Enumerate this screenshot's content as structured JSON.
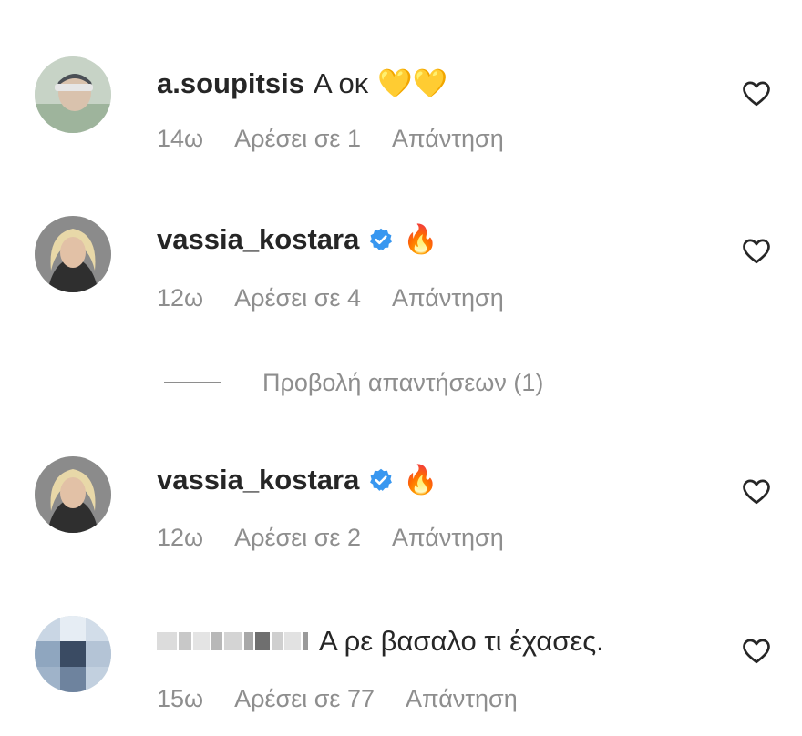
{
  "comments": [
    {
      "username": "a.soupitsis",
      "text": "Α οκ",
      "emoji": "💛💛",
      "verified": false,
      "time": "14ω",
      "likes": "Αρέσει σε 1",
      "reply": "Απάντηση"
    },
    {
      "username": "vassia_kostara",
      "text": "",
      "emoji": "🔥",
      "verified": true,
      "time": "12ω",
      "likes": "Αρέσει σε 4",
      "reply": "Απάντηση",
      "view_replies": "Προβολή απαντήσεων (1)"
    },
    {
      "username": "vassia_kostara",
      "text": "",
      "emoji": "🔥",
      "verified": true,
      "time": "12ω",
      "likes": "Αρέσει σε 2",
      "reply": "Απάντηση"
    },
    {
      "username": "",
      "text": "Α ρε βασαλο τι έχασες.",
      "emoji": "",
      "verified": false,
      "time": "15ω",
      "likes": "Αρέσει σε 77",
      "reply": "Απάντηση"
    }
  ],
  "colors": {
    "text": "#262626",
    "secondary": "#8e8e8e",
    "verified": "#3897f0"
  },
  "icons": {
    "like": "heart-outline-icon",
    "verified": "verified-badge-icon"
  }
}
